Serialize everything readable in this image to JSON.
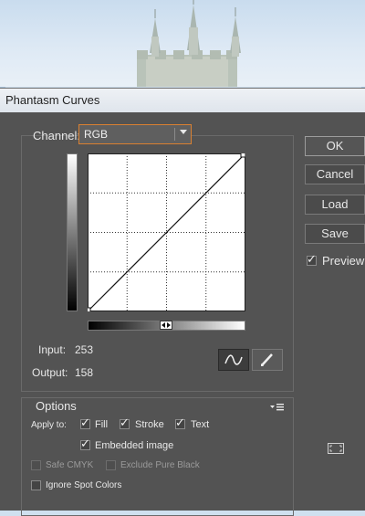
{
  "window": {
    "title": "Phantasm Curves"
  },
  "channel": {
    "label": "Channel:",
    "value": "RGB"
  },
  "readout": {
    "input_label": "Input:",
    "input_value": "253",
    "output_label": "Output:",
    "output_value": "158"
  },
  "buttons": {
    "ok": "OK",
    "cancel": "Cancel",
    "load": "Load",
    "save": "Save"
  },
  "preview": {
    "label": "Preview",
    "checked": true
  },
  "options": {
    "title": "Options",
    "apply_to_label": "Apply to:",
    "fill": "Fill",
    "stroke": "Stroke",
    "text": "Text",
    "embedded_image": "Embedded image",
    "safe_cmyk": "Safe CMYK",
    "exclude_pure_black": "Exclude Pure Black",
    "ignore_spot_colors": "Ignore Spot Colors"
  },
  "icons": {
    "curve_tool": "curve-tool-icon",
    "pencil_tool": "pencil-icon",
    "options_menu": "panel-menu-icon",
    "fit_window": "fit-window-icon"
  },
  "colors": {
    "accent": "#d98031",
    "dialog_bg": "#535353"
  }
}
